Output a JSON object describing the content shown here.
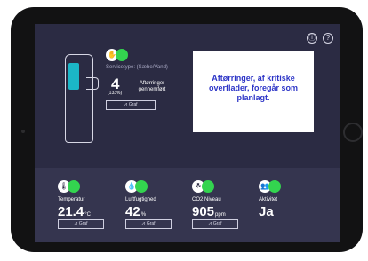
{
  "header": {
    "icons": [
      "info-icon",
      "help-icon"
    ]
  },
  "service": {
    "type_label": "Servicetype: (Sæbe/Vand)",
    "count": "4",
    "percent": "(133%)",
    "count_label": "Aftørringer gennemført",
    "graph_label": "Graf"
  },
  "message": {
    "text": "Aftørringer, af kritiske overflader, foregår som planlagt."
  },
  "metrics": {
    "temperature": {
      "label": "Temperatur",
      "value": "21.4",
      "unit": "°C",
      "graph_label": "Graf"
    },
    "humidity": {
      "label": "Luftfugtighed",
      "value": "42",
      "unit": "%",
      "graph_label": "Graf"
    },
    "co2": {
      "label": "CO2 Niveau",
      "value": "905",
      "unit": "ppm",
      "graph_label": "Graf"
    },
    "activity": {
      "label": "Aktivitet",
      "value": "Ja"
    }
  },
  "colors": {
    "screen_background": "#2a2a42",
    "status_green": "#33d44f",
    "accent_text": "#2d35c7"
  }
}
